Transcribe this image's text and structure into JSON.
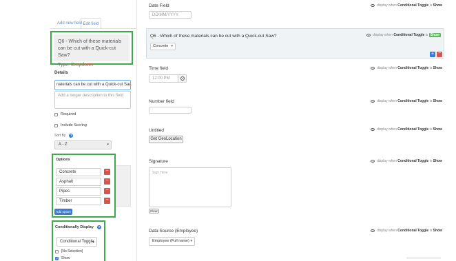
{
  "left": {
    "tabs": {
      "add": "Add new field",
      "edit": "Edit field"
    },
    "question_card": {
      "title": "Q6 - Which of these materials can be cut with a Quick-cut Saw?",
      "type_label": "Type:",
      "type_value": "Dropdown"
    },
    "details_label": "Details",
    "title_value": "naterials can be cut with a Quick-cut Saw?",
    "description_placeholder": "Add a longer description to this field",
    "required_label": "Required",
    "include_scoring_label": "Include Scoring",
    "sort_by_label": "Sort By",
    "sort_by_value": "A - Z",
    "options_label": "Options",
    "options": [
      "Concrete",
      "Asphalt",
      "Pipes",
      "Timber"
    ],
    "add_option_label": "Add option",
    "conditionally_display_label": "Conditionally Display",
    "conditional_select_value": "Conditional Toggle",
    "cond_no_selection": "[No Selection]",
    "cond_show": "Show"
  },
  "right": {
    "cond_prefix": "display when",
    "cond_toggle": "Conditional Toggle",
    "cond_is": "is",
    "cond_show": "Show",
    "date_label": "Date Field",
    "date_placeholder": "DD/MM/YYYY",
    "q6_title": "Q6 - Which of these materials can be cut with a Quick-cut Saw?",
    "q6_selected": "Concrete",
    "time_label": "Time field",
    "time_placeholder": "12:00 PM",
    "number_label": "Number field",
    "untitled_label": "Untitled",
    "geo_button": "Get GeoLocation",
    "signature_label": "Signature",
    "signature_placeholder": "Sign Here",
    "clear_button": "Clear",
    "datasource_label": "Data Source (Employee)",
    "datasource_value": "Employee (Full name)"
  },
  "colors": {
    "highlight_green": "#3aaa4a",
    "primary_blue": "#3a7bd5",
    "danger_red": "#d9534f",
    "show_green": "#5cb85c"
  }
}
